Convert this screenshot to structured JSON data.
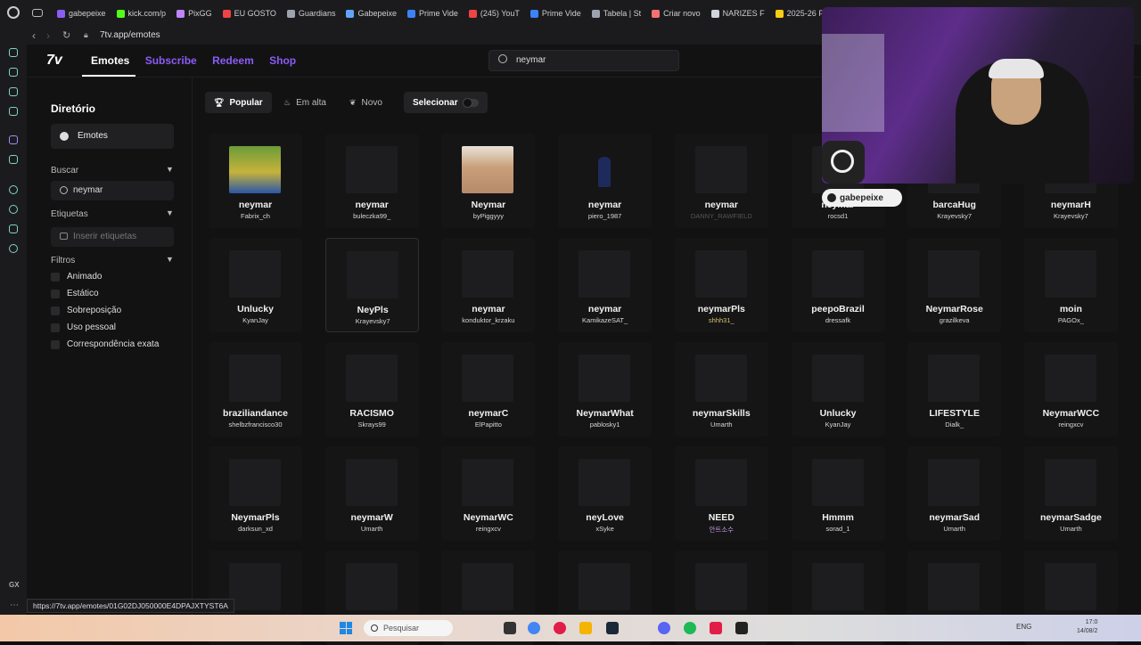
{
  "browser": {
    "tabs": [
      {
        "label": "gabepeixe",
        "color": "#8b5cf6"
      },
      {
        "label": "kick.com/p",
        "color": "#53fc18"
      },
      {
        "label": "PixGG",
        "color": "#c084fc"
      },
      {
        "label": "EU GOSTO",
        "color": "#ef4444"
      },
      {
        "label": "Guardians",
        "color": "#9ca3af"
      },
      {
        "label": "Gabepeixe",
        "color": "#60a5fa"
      },
      {
        "label": "Prime Vide",
        "color": "#3b82f6"
      },
      {
        "label": "(245) YouT",
        "color": "#ef4444"
      },
      {
        "label": "Prime Vide",
        "color": "#3b82f6"
      },
      {
        "label": "Tabela | St",
        "color": "#9ca3af"
      },
      {
        "label": "Criar novo",
        "color": "#f87171"
      },
      {
        "label": "NARIZES F",
        "color": "#d1d5db"
      },
      {
        "label": "2025-26 F",
        "color": "#facc15"
      }
    ],
    "url": "7tv.app/emotes",
    "status_url": "https://7tv.app/emotes/01G02DJ050000E4DPAJXTYST6A",
    "gx_label": "GX"
  },
  "header": {
    "logo": "7v",
    "nav": [
      "Emotes",
      "Subscribe",
      "Redeem",
      "Shop"
    ],
    "search_value": "neymar",
    "accent": "#8b5cf6"
  },
  "sidebar": {
    "title": "Diretório",
    "emotes_label": "Emotes",
    "buscar_label": "Buscar",
    "buscar_value": "neymar",
    "etiquetas_label": "Etiquetas",
    "etiquetas_placeholder": "Inserir etiquetas",
    "filtros_label": "Filtros",
    "filters": [
      "Animado",
      "Estático",
      "Sobreposição",
      "Uso pessoal",
      "Correspondência exata"
    ]
  },
  "toolbar": {
    "popular": "Popular",
    "em_alta": "Em alta",
    "novo": "Novo",
    "selecionar": "Selecionar"
  },
  "emotes": [
    {
      "name": "neymar",
      "owner": "Fabrix_ch",
      "thumb": "photo-green"
    },
    {
      "name": "neymar",
      "owner": "buleczka99_",
      "thumb": "blank"
    },
    {
      "name": "Neymar",
      "owner": "byPiggyyy",
      "thumb": "photo-face"
    },
    {
      "name": "neymar",
      "owner": "piero_1987",
      "thumb": "photo-player"
    },
    {
      "name": "neymar",
      "owner": "DANNY_RAWFIELD",
      "thumb": "blank",
      "style": "dim"
    },
    {
      "name": "neymar",
      "owner": "rocsd1",
      "thumb": "blank"
    },
    {
      "name": "barcaHug",
      "owner": "Krayevsky7",
      "thumb": "blank"
    },
    {
      "name": "neymarH",
      "owner": "Krayevsky7",
      "thumb": "blank"
    },
    {
      "name": "Unlucky",
      "owner": "KyanJay",
      "thumb": "blank"
    },
    {
      "name": "NeyPls",
      "owner": "Krayevsky7",
      "thumb": "blank",
      "hover": true
    },
    {
      "name": "neymar",
      "owner": "konduktor_krzaku",
      "thumb": "blank"
    },
    {
      "name": "neymar",
      "owner": "KamikazeSAT_",
      "thumb": "blank"
    },
    {
      "name": "neymarPls",
      "owner": "shhh31_",
      "thumb": "blank",
      "style": "gold"
    },
    {
      "name": "peepoBrazil",
      "owner": "dressafk",
      "thumb": "blank"
    },
    {
      "name": "NeymarRose",
      "owner": "grazilkeva",
      "thumb": "blank"
    },
    {
      "name": "moin",
      "owner": "PAGOx_",
      "thumb": "blank"
    },
    {
      "name": "braziliandance",
      "owner": "shelbzfrancisco30",
      "thumb": "blank"
    },
    {
      "name": "RACISMO",
      "owner": "Skrays99",
      "thumb": "blank"
    },
    {
      "name": "neymarC",
      "owner": "ElPapitto",
      "thumb": "blank"
    },
    {
      "name": "NeymarWhat",
      "owner": "pablosky1",
      "thumb": "blank"
    },
    {
      "name": "neymarSkills",
      "owner": "Umarth",
      "thumb": "blank"
    },
    {
      "name": "Unlucky",
      "owner": "KyanJay",
      "thumb": "blank"
    },
    {
      "name": "LIFESTYLE",
      "owner": "Dialk_",
      "thumb": "blank"
    },
    {
      "name": "NeymarWCC",
      "owner": "reingxcv",
      "thumb": "blank"
    },
    {
      "name": "NeymarPls",
      "owner": "darksun_xd",
      "thumb": "blank"
    },
    {
      "name": "neymarW",
      "owner": "Umarth",
      "thumb": "blank"
    },
    {
      "name": "NeymarWC",
      "owner": "reingxcv",
      "thumb": "blank"
    },
    {
      "name": "neyLove",
      "owner": "xSyke",
      "thumb": "blank"
    },
    {
      "name": "NEED",
      "owner": "안트소수",
      "thumb": "blank",
      "style": "purple"
    },
    {
      "name": "Hmmm",
      "owner": "sorad_1",
      "thumb": "blank"
    },
    {
      "name": "neymarSad",
      "owner": "Umarth",
      "thumb": "blank"
    },
    {
      "name": "neymarSadge",
      "owner": "Umarth",
      "thumb": "blank"
    },
    {
      "name": "",
      "owner": "",
      "thumb": "blank"
    },
    {
      "name": "",
      "owner": "",
      "thumb": "blank"
    },
    {
      "name": "",
      "owner": "",
      "thumb": "blank"
    },
    {
      "name": "",
      "owner": "",
      "thumb": "blank"
    },
    {
      "name": "",
      "owner": "",
      "thumb": "blank"
    },
    {
      "name": "",
      "owner": "",
      "thumb": "blank"
    },
    {
      "name": "",
      "owner": "",
      "thumb": "blank"
    },
    {
      "name": "",
      "owner": "",
      "thumb": "blank"
    }
  ],
  "overlay": {
    "channel_name": "gabepeixe"
  },
  "taskbar": {
    "search_placeholder": "Pesquisar",
    "tray_lang": "ENG",
    "time": "17:0",
    "date": "14/08/2"
  }
}
